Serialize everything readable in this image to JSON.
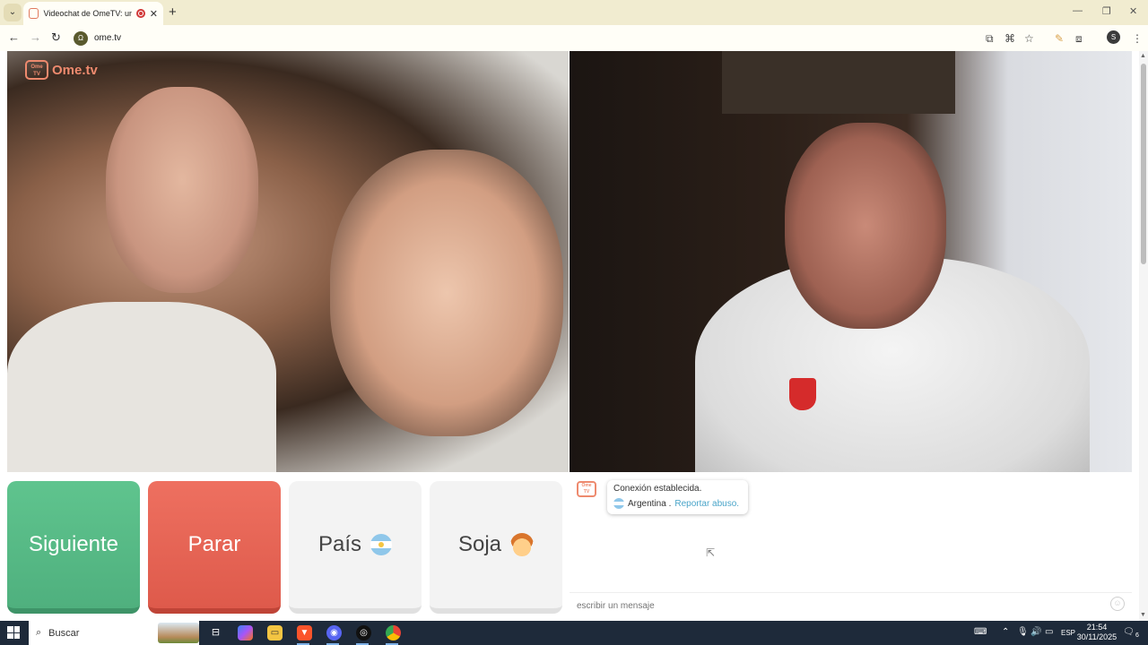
{
  "browser": {
    "tab_title": "Videochat de OmeTV: una ...",
    "tab_close": "✕",
    "new_tab": "+",
    "url": "ome.tv",
    "site_icon_text": "Ω",
    "profile_letter": "S",
    "window": {
      "minimize": "—",
      "restore": "❐",
      "close": "✕"
    }
  },
  "page": {
    "logo_badge_text": "Ome TV",
    "logo_text": "Ome.tv",
    "buttons": {
      "next": "Siguiente",
      "stop": "Parar",
      "country": "País",
      "gender": "Soja"
    },
    "chat": {
      "logo_badge_text": "Ome TV",
      "status": "Conexión establecida.",
      "country": "Argentina .",
      "report": "Reportar abuso.",
      "input_placeholder": "escribir un mensaje"
    }
  },
  "taskbar": {
    "search_placeholder": "Buscar",
    "lang": "ESP",
    "time": "21:54",
    "date": "30/11/2025",
    "notification_count": "6"
  },
  "colors": {
    "next_button": "#5fc48e",
    "stop_button": "#ee7060",
    "brand": "#ee8a6e",
    "report_link": "#4aa5c9"
  }
}
